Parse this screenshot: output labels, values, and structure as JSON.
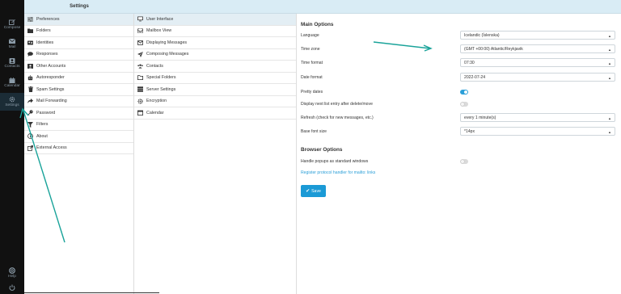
{
  "nav": {
    "items": [
      {
        "label": "Compose",
        "icon": "compose-icon"
      },
      {
        "label": "Mail",
        "icon": "mail-icon"
      },
      {
        "label": "Contacts",
        "icon": "contacts-icon"
      },
      {
        "label": "Calendar",
        "icon": "calendar-icon"
      },
      {
        "label": "Settings",
        "icon": "gear-icon",
        "active": true
      }
    ],
    "help": {
      "label": "Help",
      "icon": "help-icon"
    }
  },
  "settings_header": "Settings",
  "settings_menu": [
    {
      "label": "Preferences",
      "icon": "sliders-icon",
      "selected": true
    },
    {
      "label": "Folders",
      "icon": "folder-icon"
    },
    {
      "label": "Identities",
      "icon": "id-card-icon"
    },
    {
      "label": "Responses",
      "icon": "chat-icon"
    },
    {
      "label": "Other Accounts",
      "icon": "accounts-icon"
    },
    {
      "label": "Autoresponder",
      "icon": "robot-icon"
    },
    {
      "label": "Spam Settings",
      "icon": "trash-icon"
    },
    {
      "label": "Mail Forwarding",
      "icon": "forward-icon"
    },
    {
      "label": "Password",
      "icon": "key-icon"
    },
    {
      "label": "Filters",
      "icon": "filter-icon"
    },
    {
      "label": "About",
      "icon": "info-icon"
    },
    {
      "label": "External Access",
      "icon": "external-link-icon"
    }
  ],
  "pref_sections": [
    {
      "label": "User Interface",
      "icon": "monitor-icon",
      "selected": true
    },
    {
      "label": "Mailbox View",
      "icon": "inbox-icon"
    },
    {
      "label": "Displaying Messages",
      "icon": "envelope-icon"
    },
    {
      "label": "Composing Messages",
      "icon": "send-icon"
    },
    {
      "label": "Contacts",
      "icon": "contacts-icon"
    },
    {
      "label": "Special Folders",
      "icon": "folder-icon"
    },
    {
      "label": "Server Settings",
      "icon": "server-icon"
    },
    {
      "label": "Encryption",
      "icon": "gear-icon"
    },
    {
      "label": "Calendar",
      "icon": "calendar-icon"
    }
  ],
  "main": {
    "title": "Main Options",
    "language": {
      "label": "Language",
      "value": "Icelandic (Íslenska)"
    },
    "timezone": {
      "label": "Time zone",
      "value": "(GMT +00:00) Atlantic/Reykjavik"
    },
    "time_format": {
      "label": "Time format",
      "value": "07:30"
    },
    "date_format": {
      "label": "Date format",
      "value": "2022-07-24"
    },
    "pretty_dates": {
      "label": "Pretty dates",
      "on": true
    },
    "display_next": {
      "label": "Display next list entry after delete/move",
      "on": false
    },
    "refresh": {
      "label": "Refresh (check for new messages, etc.)",
      "value": "every 1 minute(s)"
    },
    "font_size": {
      "label": "Base font size",
      "value": "*14px"
    },
    "browser_title": "Browser Options",
    "popups": {
      "label": "Handle popups as standard windows",
      "on": false
    },
    "protocol_link": "Register protocol handler for mailto: links",
    "save_label": "Save"
  },
  "colors": {
    "accent": "#2b9fd8",
    "annotation": "#1aa39a"
  }
}
